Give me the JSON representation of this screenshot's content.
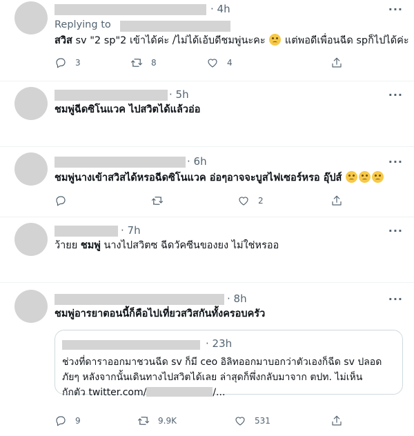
{
  "tweets": [
    {
      "time": "· 4h",
      "replying_to": "Replying to",
      "text_bold1": "สวิส",
      "text_part1": " sv ",
      "text_part2": "2 sp",
      "text_part3": "2 เข้าได้ค่ะ /ไม่ได้เอ้บดีชมพู่นะคะ",
      "text_part4": " แต่พอดีเพื่อนฉีด spก็ไปได้ค่ะ",
      "replies": "3",
      "retweets": "8",
      "likes": "4"
    },
    {
      "time": "· 5h",
      "text": "ชมพู่ฉีดซิโนแวค ไปสวิตได้แล้วอ่อ"
    },
    {
      "time": "· 6h",
      "text": "ชมพู่นางเข้าสวิสได้หรอฉีดซิโนแวค อ่อๆอาจจะบูสไฟเซอร์หรอ อุ๊ปส์",
      "likes": "2"
    },
    {
      "time": "· 7h",
      "text_pre": "ว้ายย ",
      "text_bold": "ชมพู่",
      "text_post": " นางไปสวิตซ ฉีดวัคซีนของยง ไม่ใช่หรออ"
    },
    {
      "time": "· 8h",
      "text": "ชมพู่อารยาตอนนี้ก็คือไปเที่ยวสวิสกันทั้งครอบครัว",
      "quote": {
        "time": "· 23h",
        "line1": "ช่วงที่ดาราออกมาชวนฉีด sv ก็มี ceo อิลิทออกมาบอกว่าตัวเองก็ฉีด sv ปลอด",
        "line2": "ภัยๆ หลังจากนั้นเดินทางไปสวิตได้เลย ล่าสุดก็พึ่งกลับมาจาก ตปท. ไม่เห็น",
        "line3_pre": "กักตัว twitter.com/",
        "line3_post": "/..."
      },
      "replies": "9",
      "retweets": "9.9K",
      "likes": "531"
    }
  ],
  "icons": {
    "reply": "reply-icon",
    "retweet": "retweet-icon",
    "like": "heart-icon",
    "share": "share-icon",
    "more": "more-icon"
  },
  "more_glyph": "···"
}
